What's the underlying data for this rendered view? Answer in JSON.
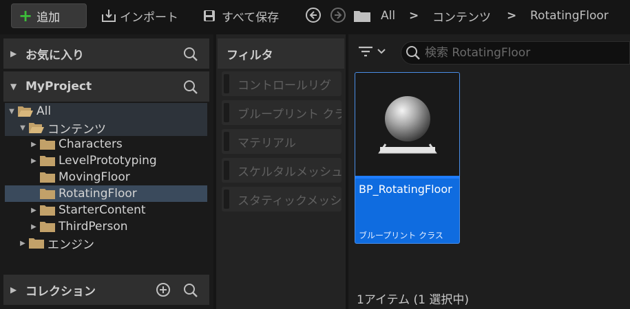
{
  "toolbar": {
    "add_label": "追加",
    "import_label": "インポート",
    "save_all_label": "すべて保存",
    "breadcrumb": [
      "All",
      "コンテンツ",
      "RotatingFloor"
    ],
    "separator": ">"
  },
  "left": {
    "favorites_label": "お気に入り",
    "project_label": "MyProject",
    "collections_label": "コレクション",
    "tree": [
      {
        "label": "All"
      },
      {
        "label": "コンテンツ"
      },
      {
        "label": "Characters"
      },
      {
        "label": "LevelPrototyping"
      },
      {
        "label": "MovingFloor"
      },
      {
        "label": "RotatingFloor"
      },
      {
        "label": "StarterContent"
      },
      {
        "label": "ThirdPerson"
      },
      {
        "label": "エンジン"
      }
    ]
  },
  "filters": {
    "title": "フィルタ",
    "items": [
      "コントロールリグ",
      "ブループリント クラス",
      "マテリアル",
      "スケルタルメッシュ",
      "スタティックメッシュ"
    ]
  },
  "content": {
    "search_placeholder": "検索 RotatingFloor",
    "asset": {
      "name": "BP_RotatingFloor",
      "type": "ブループリント クラス"
    },
    "status": "1アイテム (1 選択中)"
  },
  "colors": {
    "accent": "#0f6ce0",
    "add_plus": "#3dbd3a",
    "folder": "#c2a169",
    "selected_row": "#3a4a5c"
  },
  "icons": [
    "plus-icon",
    "import-icon",
    "save-icon",
    "back-arrow-icon",
    "forward-arrow-icon",
    "folder-icon",
    "search-icon",
    "filter-icon",
    "chevron-down-icon",
    "add-circle-icon",
    "folder-open-icon"
  ]
}
